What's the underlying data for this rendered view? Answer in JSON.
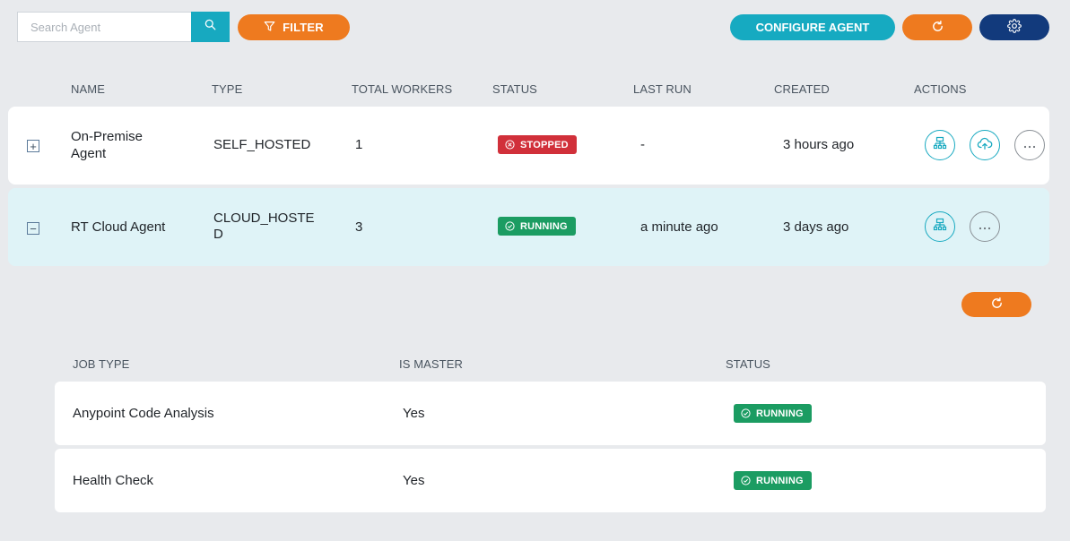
{
  "toolbar": {
    "search_placeholder": "Search Agent",
    "filter_label": "FILTER",
    "configure_label": "CONFIGURE AGENT"
  },
  "agents_table": {
    "headers": [
      "NAME",
      "TYPE",
      "TOTAL WORKERS",
      "STATUS",
      "LAST RUN",
      "CREATED",
      "ACTIONS"
    ],
    "rows": [
      {
        "expander": "+",
        "name": "On-Premise Agent",
        "type": "SELF_HOSTED",
        "total_workers": "1",
        "status": "STOPPED",
        "last_run": "-",
        "created": "3 hours ago"
      },
      {
        "expander": "−",
        "name": "RT Cloud Agent",
        "type": "CLOUD_HOSTED",
        "total_workers": "3",
        "status": "RUNNING",
        "last_run": "a minute ago",
        "created": "3 days ago"
      }
    ]
  },
  "jobs_table": {
    "headers": [
      "JOB TYPE",
      "IS MASTER",
      "STATUS"
    ],
    "rows": [
      {
        "job_type": "Anypoint Code Analysis",
        "is_master": "Yes",
        "status": "RUNNING"
      },
      {
        "job_type": "Health Check",
        "is_master": "Yes",
        "status": "RUNNING"
      }
    ]
  },
  "colors": {
    "accent_teal": "#16aac1",
    "accent_orange": "#ee7a1f",
    "navy": "#123a7c",
    "status_running": "#1b9c62",
    "status_stopped": "#d1303a"
  },
  "icons": [
    "search-icon",
    "filter-icon",
    "refresh-icon",
    "gear-icon",
    "hierarchy-icon",
    "cloud-upload-icon",
    "more-icon",
    "x-circle-icon",
    "check-circle-icon"
  ]
}
